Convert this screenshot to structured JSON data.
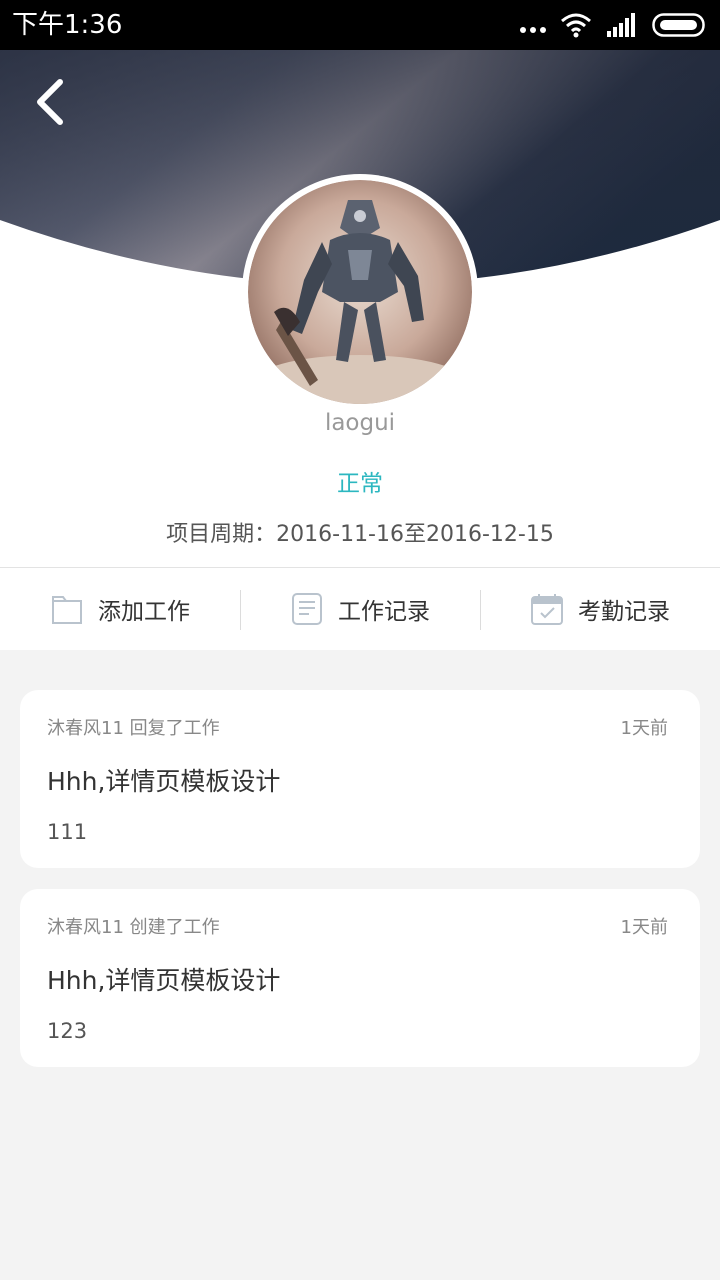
{
  "status_bar": {
    "time": "下午1:36"
  },
  "profile": {
    "username": "laogui",
    "status": "正常",
    "period": "项目周期：2016-11-16至2016-12-15"
  },
  "actions": [
    {
      "label": "添加工作",
      "icon": "folder-icon"
    },
    {
      "label": "工作记录",
      "icon": "document-icon"
    },
    {
      "label": "考勤记录",
      "icon": "calendar-check-icon"
    }
  ],
  "feed": [
    {
      "meta": "沐春风11 回复了工作",
      "time": "1天前",
      "title": "Hhh,详情页模板设计",
      "body": "111"
    },
    {
      "meta": "沐春风11 创建了工作",
      "time": "1天前",
      "title": "Hhh,详情页模板设计",
      "body": "123"
    }
  ],
  "colors": {
    "accent": "#2cb7c0",
    "header_dark": "#1f2a3c",
    "page_bg": "#f3f3f3"
  }
}
